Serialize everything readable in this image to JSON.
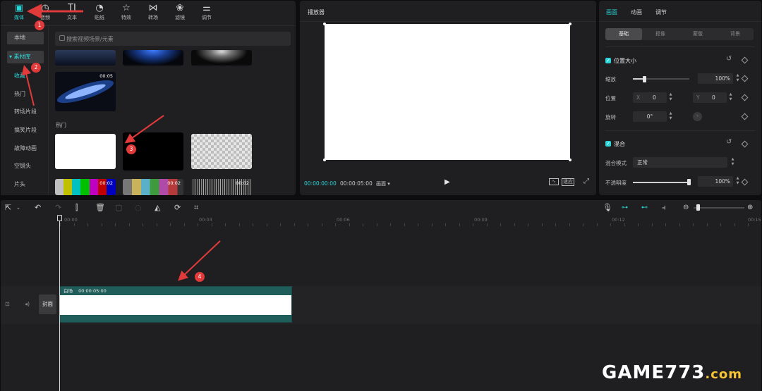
{
  "media_panel": {
    "tabs": [
      {
        "label": "媒体",
        "icon": "media-icon"
      },
      {
        "label": "音频",
        "icon": "audio-icon"
      },
      {
        "label": "文本",
        "icon": "text-icon"
      },
      {
        "label": "贴纸",
        "icon": "sticker-icon"
      },
      {
        "label": "特效",
        "icon": "effects-icon"
      },
      {
        "label": "转场",
        "icon": "transition-icon"
      },
      {
        "label": "滤镜",
        "icon": "filter-icon"
      },
      {
        "label": "调节",
        "icon": "adjust-icon"
      }
    ],
    "sidebar": {
      "local": "本地",
      "library": "▾ 素材库",
      "items": [
        "收藏",
        "热门",
        "转场片段",
        "搞笑片段",
        "故障动画",
        "空镜头",
        "片头"
      ]
    },
    "search_placeholder": "搜索视频场景/元素",
    "section_hot": "热门",
    "thumbs": {
      "dur_a": "00:05",
      "dur_b": "00:02",
      "dur_c": "00:02",
      "dur_d": "00:02"
    }
  },
  "player": {
    "title": "播放器",
    "current_time": "00:00:00:00",
    "total_time": "00:00:05:00",
    "ratio_label": "画面 ▾",
    "fit_label": "适应"
  },
  "inspector": {
    "tabs": [
      "画面",
      "动画",
      "调节"
    ],
    "subtabs": [
      "基础",
      "抠像",
      "蒙版",
      "背景"
    ],
    "position_size": "位置大小",
    "scale_label": "缩放",
    "scale_value": "100%",
    "position_label": "位置",
    "x_label": "X",
    "x_value": "0",
    "y_label": "Y",
    "y_value": "0",
    "rotate_label": "旋转",
    "rotate_value": "0°",
    "blend": "混合",
    "blend_mode_label": "混合模式",
    "blend_mode_value": "正常",
    "opacity_label": "不透明度",
    "opacity_value": "100%",
    "scale_fraction": 0.2,
    "opacity_fraction": 1.0
  },
  "timeline": {
    "ruler": [
      "00:00",
      "00:03",
      "00:06",
      "00:09",
      "00:12",
      "00:15"
    ],
    "clip_name": "白场",
    "clip_duration": "00:00:05:00",
    "cover_label": "封面"
  },
  "annotations": [
    "1",
    "2",
    "3",
    "4"
  ],
  "watermark": {
    "text": "GAME773",
    "suffix": ".com"
  },
  "colors": {
    "accent": "#2bd4d7",
    "annotation": "#e03a3a",
    "clip": "#1f5d5a"
  }
}
